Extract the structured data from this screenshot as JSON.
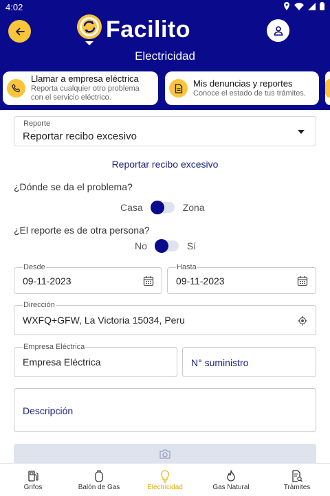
{
  "status_bar": {
    "time": "4:02"
  },
  "header": {
    "logo_text": "Facilito",
    "subtitle": "Electricidad"
  },
  "quick_actions": [
    {
      "title": "Llamar a empresa eléctrica",
      "subtitle_line1": "Reporta cualquier otro problema",
      "subtitle_line2": "con el servicio eléctrico."
    },
    {
      "title": "Mis denuncias y reportes",
      "subtitle_line1": "Conoce el estado de tus trámites."
    }
  ],
  "form": {
    "reporte": {
      "label": "Reporte",
      "value": "Reportar recibo excesivo"
    },
    "section_title": "Reportar recibo excesivo",
    "q1": {
      "question": "¿Dónde se da el problema?",
      "left": "Casa",
      "right": "Zona"
    },
    "q2": {
      "question": "¿El reporte es de otra persona?",
      "left": "No",
      "right": "Sí"
    },
    "desde": {
      "label": "Desde",
      "value": "09-11-2023"
    },
    "hasta": {
      "label": "Hasta",
      "value": "09-11-2023"
    },
    "direccion": {
      "label": "Dirección",
      "value": "WXFQ+GFW, La Victoria 15034, Peru"
    },
    "empresa": {
      "label": "Empresa Eléctrica",
      "value": "Empresa Eléctrica"
    },
    "suministro": {
      "placeholder": "N° suministro"
    },
    "descripcion": {
      "placeholder": "Descripción"
    }
  },
  "bottom_nav": [
    {
      "label": "Grifos",
      "icon": "gas-pump-icon"
    },
    {
      "label": "Balón de Gas",
      "icon": "gas-cylinder-icon"
    },
    {
      "label": "Electricidad",
      "icon": "lightbulb-icon",
      "active": true
    },
    {
      "label": "Gas Natural",
      "icon": "flame-icon"
    },
    {
      "label": "Trámites",
      "icon": "document-search-icon"
    }
  ],
  "colors": {
    "primary": "#0a0a8c",
    "accent": "#fbc53b"
  }
}
